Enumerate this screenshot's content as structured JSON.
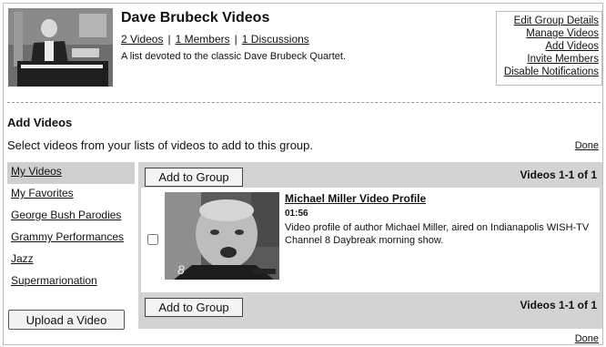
{
  "group": {
    "title": "Dave Brubeck Videos",
    "videos_link": "2 Videos",
    "members_link": "1 Members",
    "discussions_link": "1 Discussions",
    "separator": "|",
    "description": "A list devoted to the classic Dave Brubeck Quartet."
  },
  "admin_links": [
    "Edit Group Details",
    "Manage Videos",
    "Add Videos",
    "Invite Members",
    "Disable Notifications"
  ],
  "add_videos": {
    "title": "Add Videos",
    "intro": "Select videos from your lists of videos to add to this group.",
    "done": "Done"
  },
  "lists": [
    "My Videos",
    "My Favorites",
    "George Bush Parodies",
    "Grammy Performances",
    "Jazz",
    "Supermarionation"
  ],
  "upload_button": "Upload a Video",
  "panel": {
    "add_button": "Add to Group",
    "count": "Videos 1-1 of 1"
  },
  "video": {
    "title": "Michael Miller Video Profile",
    "duration": "01:56",
    "description": "Video profile of author Michael Miller, aired on Indianapolis WISH-TV Channel 8 Daybreak morning show.",
    "checked": false
  }
}
